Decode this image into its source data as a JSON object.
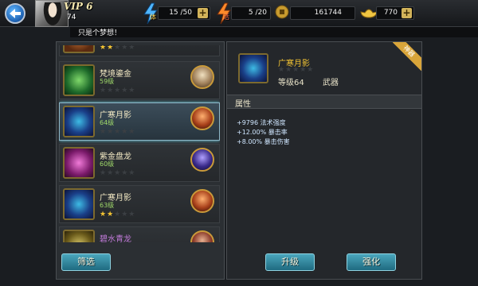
{
  "player": {
    "vip": "VIP 6",
    "level": "74"
  },
  "resources": {
    "stamina": {
      "label": "体",
      "value": "15 /50"
    },
    "energy": {
      "label": "活",
      "value": "5 /20"
    },
    "coins": {
      "value": "161744"
    },
    "ingots": {
      "value": "770"
    }
  },
  "message": "只是个梦想！",
  "items": [
    {
      "name": "",
      "level": "",
      "stars_on": 2,
      "stars_total": 5
    },
    {
      "name": "梵境鎏金",
      "level": "59级",
      "stars_on": 0,
      "stars_total": 5
    },
    {
      "name": "广寒月影",
      "level": "64级",
      "stars_on": 0,
      "stars_total": 5
    },
    {
      "name": "紫金盘龙",
      "level": "60级",
      "stars_on": 0,
      "stars_total": 5
    },
    {
      "name": "广寒月影",
      "level": "63级",
      "stars_on": 2,
      "stars_total": 5
    },
    {
      "name": "碧水青龙",
      "level": "",
      "stars_on": 0,
      "stars_total": 5
    }
  ],
  "buttons": {
    "filter": "筛选",
    "upgrade": "升级",
    "enhance": "强化"
  },
  "detail": {
    "name": "广寒月影",
    "level": "等级64",
    "type": "武器",
    "ribbon": "神器",
    "attr_title": "属性",
    "attributes": [
      "+9796 法术强度",
      "+12.00% 暴击率",
      "+8.00% 暴击伤害"
    ]
  },
  "colors": {
    "accent": "#4aa6bd",
    "gold": "#f3c433",
    "green": "#9fd86a"
  }
}
